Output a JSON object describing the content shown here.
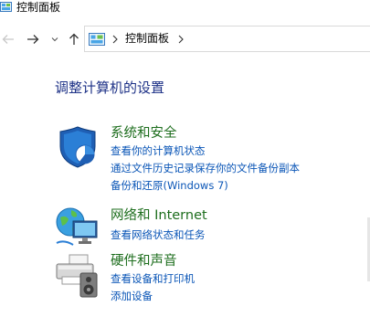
{
  "window": {
    "title": "控制面板"
  },
  "navigation": {
    "breadcrumb": "控制面板"
  },
  "main": {
    "heading": "调整计算机的设置",
    "categories": [
      {
        "title": "系统和安全",
        "icon": "shield-icon",
        "links": [
          "查看你的计算机状态",
          "通过文件历史记录保存你的文件备份副本",
          "备份和还原(Windows 7)"
        ]
      },
      {
        "title": "网络和 Internet",
        "icon": "network-globe-icon",
        "links": [
          "查看网络状态和任务"
        ]
      },
      {
        "title": "硬件和声音",
        "icon": "printer-speaker-icon",
        "links": [
          "查看设备和打印机",
          "添加设备"
        ]
      }
    ]
  },
  "colors": {
    "heading": "#1e3287",
    "category_title": "#1e6e1e",
    "link": "#0b56b7"
  }
}
